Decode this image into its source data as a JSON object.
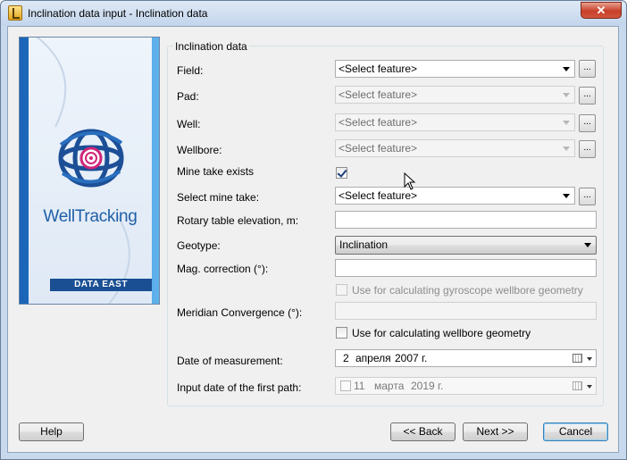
{
  "window": {
    "title": "Inclination data input - Inclination data",
    "close_label": "✕"
  },
  "banner": {
    "brand": "WellTracking",
    "vendor": "DATA EAST"
  },
  "group": {
    "title": "Inclination data"
  },
  "fields": {
    "field_label": "Field:",
    "field_value": "<Select feature>",
    "pad_label": "Pad:",
    "pad_value": "<Select feature>",
    "well_label": "Well:",
    "well_value": "<Select feature>",
    "wellbore_label": "Wellbore:",
    "wellbore_value": "<Select feature>",
    "mine_take_exists_label": "Mine take exists",
    "select_mine_take_label": "Select mine take:",
    "select_mine_take_value": "<Select feature>",
    "rotary_label": "Rotary table elevation, m:",
    "rotary_value": "",
    "geotype_label": "Geotype:",
    "geotype_value": "Inclination",
    "mag_label": "Mag. correction (°):",
    "mag_value": "",
    "gyro_check_label": "Use for calculating gyroscope wellbore geometry",
    "meridian_label": "Meridian Convergence (°):",
    "meridian_value": "",
    "wellbore_check_label": "Use for calculating wellbore geometry",
    "date_label": "Date of measurement:",
    "date_day": "2",
    "date_month": "апреля",
    "date_year": "2007 г.",
    "input_date_label": "Input date of the first path:",
    "input_day": "11",
    "input_month": "марта",
    "input_year": "2019 г.",
    "dots": "..."
  },
  "buttons": {
    "help": "Help",
    "back": "<< Back",
    "next": "Next >>",
    "cancel": "Cancel"
  },
  "state": {
    "mine_take_exists_checked": true,
    "gyro_checked": false,
    "wellbore_geometry_checked": false,
    "input_date_enabled": false
  },
  "colors": {
    "titlebar": "#c2d5ec",
    "client_bg": "#f0f0f0",
    "banner_blue": "#1a63b6",
    "accent_pink": "#d0267a"
  },
  "icons": {
    "dropdown": "chevron-down-icon",
    "calendar": "calendar-icon",
    "cursor": "mouse-pointer-icon"
  }
}
